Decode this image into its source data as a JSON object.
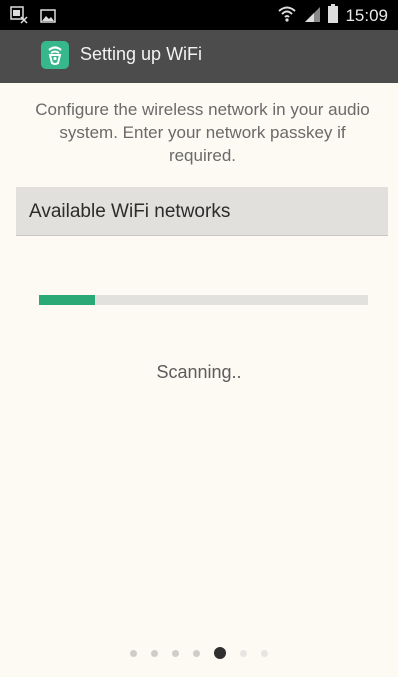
{
  "status_bar": {
    "time": "15:09",
    "icons": [
      "screenshot-icon",
      "image-icon",
      "wifi-icon",
      "signal-icon",
      "battery-icon"
    ]
  },
  "action_bar": {
    "title": "Setting up WiFi",
    "app_icon": "wifi-speaker-icon",
    "accent_color": "#36b88c"
  },
  "intro_text": "Configure the wireless network in your audio system. Enter your network passkey if required.",
  "section": {
    "title": "Available WiFi networks"
  },
  "scan": {
    "progress_fraction": 0.17,
    "status": "Scanning..",
    "progress_color": "#2aa875"
  },
  "pager": {
    "total": 7,
    "current_index": 4
  }
}
